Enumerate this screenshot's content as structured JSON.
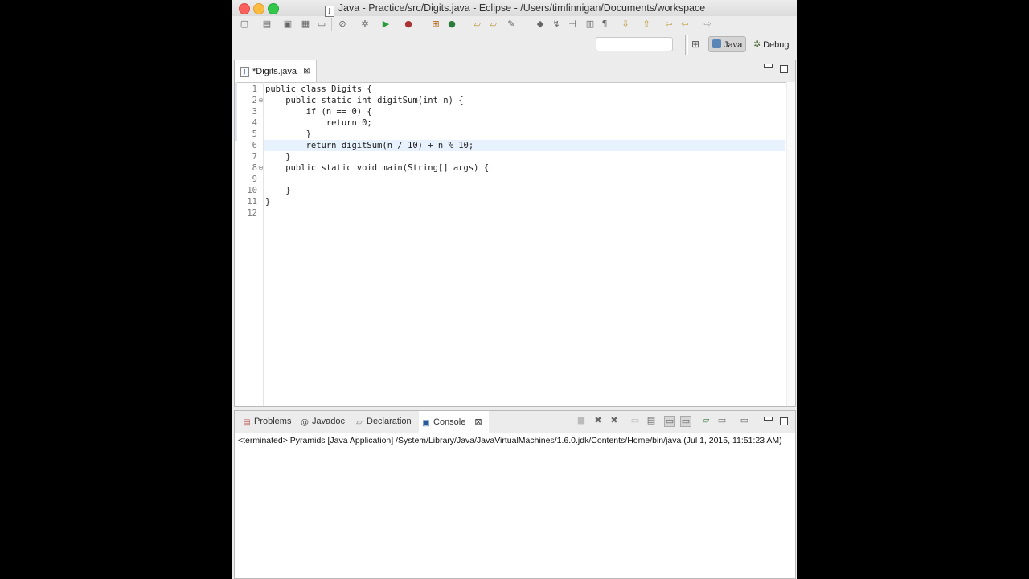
{
  "window": {
    "title": "Java - Practice/src/Digits.java - Eclipse - /Users/timfinnigan/Documents/workspace",
    "title_icon": "J"
  },
  "perspectives": {
    "java_label": "Java",
    "debug_label": "Debug"
  },
  "editor": {
    "tab_label": "*Digits.java",
    "tab_icon": "J",
    "line_numbers": [
      "1",
      "2",
      "3",
      "4",
      "5",
      "6",
      "7",
      "8",
      "9",
      "10",
      "11",
      "12"
    ],
    "lines": [
      "public class Digits {",
      "    public static int digitSum(int n) {",
      "        if (n == 0) {",
      "            return 0;",
      "        }",
      "        return digitSum(n / 10) + n % 10;",
      "    }",
      "    public static void main(String[] args) {",
      "",
      "    }",
      "}",
      ""
    ]
  },
  "bottom_panel": {
    "tabs": [
      {
        "label": "Problems",
        "icon": "problems-icon"
      },
      {
        "label": "Javadoc",
        "icon": "at-icon"
      },
      {
        "label": "Declaration",
        "icon": "declaration-icon"
      },
      {
        "label": "Console",
        "icon": "console-icon"
      }
    ],
    "console_status": "<terminated> Pyramids [Java Application] /System/Library/Java/JavaVirtualMachines/1.6.0.jdk/Contents/Home/bin/java (Jul 1, 2015, 11:51:23 AM)"
  },
  "colors": {
    "close": "#fc605c",
    "minimize": "#fdbc40",
    "zoom": "#34c84a",
    "current_line": "#e8f2fe",
    "occurrence_highlight": "#e6dada"
  }
}
